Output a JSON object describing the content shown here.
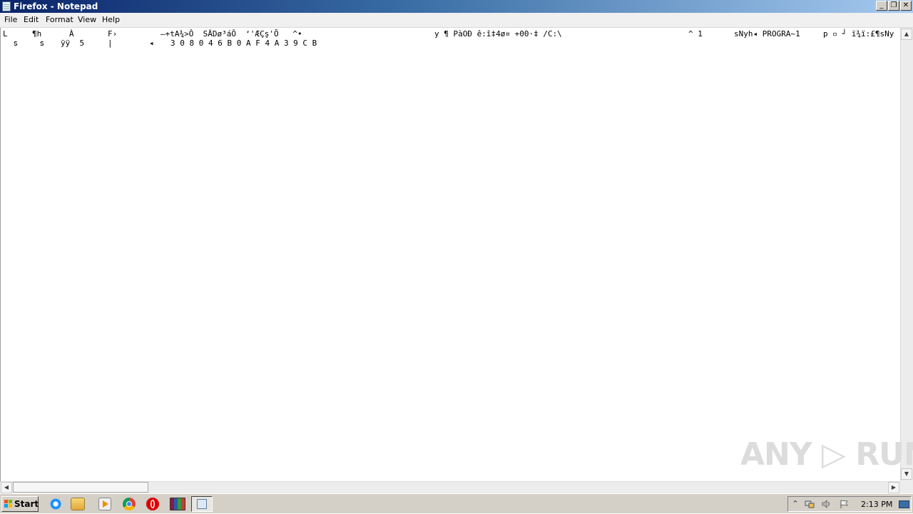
{
  "window": {
    "title": "Firefox - Notepad",
    "minimize_glyph": "_",
    "maximize_glyph": "❐",
    "close_glyph": "✕"
  },
  "menu": {
    "file": "File",
    "edit": "Edit",
    "format": "Format",
    "view": "View",
    "help": "Help"
  },
  "document": {
    "segments": [
      "L",
      "¶h",
      "À",
      "F›",
      "—+tA¾>Ô  SÄDø³áÔ  ‘'ÆÇş'Õ   ^•",
      "y ¶ PàOÐ ê:î‡4ø¤ +00·‡ /C:\\",
      "^ 1",
      "sNyh◂ PROGRA~1",
      "p ▫ ┘ ï¾ï:£¶sNy"
    ],
    "segments2": [
      "ꜱ",
      "ꜱ",
      "ÿÿ  5",
      "|",
      "◂",
      "3 0 8 0 4 6 B 0 A F 4 A 3 9 C B"
    ]
  },
  "scrollbar": {
    "up_glyph": "▲",
    "down_glyph": "▼",
    "left_glyph": "◀",
    "right_glyph": "▶"
  },
  "watermark": "ANY ▷ RUN",
  "taskbar": {
    "start_label": "Start",
    "clock": "2:13 PM",
    "tray_expand_glyph": "⌃",
    "icons": [
      "internet-explorer-icon",
      "file-explorer-icon",
      "media-player-icon",
      "chrome-icon",
      "opera-icon",
      "winrar-icon",
      "notepad-icon"
    ]
  },
  "colors": {
    "titlebar_start": "#0a246a",
    "titlebar_end": "#a6caf0",
    "taskbar": "#d4d0c8"
  }
}
